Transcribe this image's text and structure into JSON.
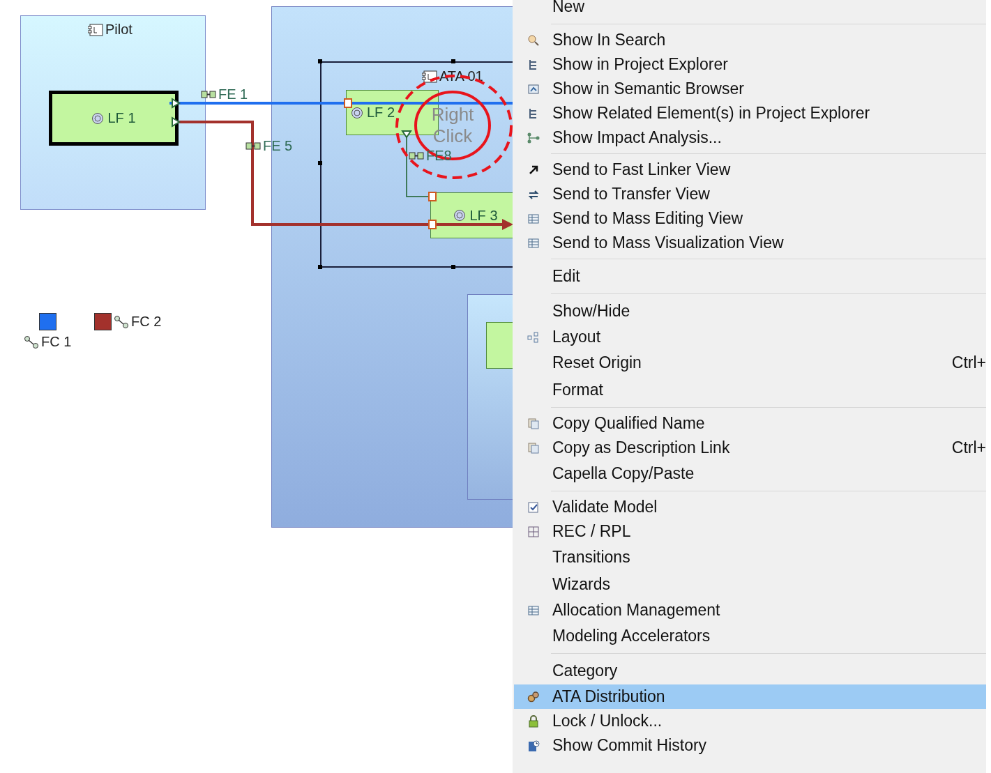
{
  "diagram": {
    "containers": [
      {
        "kind": "component",
        "label": "Pilot"
      },
      {
        "kind": "outer"
      },
      {
        "kind": "frame",
        "label": "ATA 01",
        "selected": true
      },
      {
        "kind": "inner"
      }
    ],
    "functions": [
      {
        "label": "LF 1",
        "selected": true
      },
      {
        "label": "LF 2",
        "selected": false
      },
      {
        "label": "LF 3",
        "selected": false
      },
      {
        "selected": false
      }
    ],
    "exchanges": [
      {
        "label": "FE 1",
        "color": "#1f6fef"
      },
      {
        "label": "FE 5",
        "color": "#a3312c"
      },
      {
        "label": "FE8",
        "color": "#3f7a5a"
      }
    ],
    "legend": [
      {
        "label": "FC 1",
        "color": "#1f6fef"
      },
      {
        "label": "FC 2",
        "color": "#a3312c"
      }
    ],
    "annotation": {
      "text": "Right Click"
    }
  },
  "context_menu": {
    "items": [
      {
        "kind": "item",
        "label": "New"
      },
      {
        "kind": "separator"
      },
      {
        "kind": "item",
        "label": "Show In Search",
        "selected": false
      },
      {
        "kind": "item",
        "label": "Show in Project Explorer",
        "selected": false
      },
      {
        "kind": "item",
        "label": "Show in Semantic Browser",
        "selected": false
      },
      {
        "kind": "item",
        "label": "Show Related Element(s) in Project Explorer",
        "selected": false
      },
      {
        "kind": "item",
        "label": "Show Impact Analysis...",
        "selected": false
      },
      {
        "kind": "separator"
      },
      {
        "kind": "item",
        "label": "Send to Fast Linker View",
        "selected": false
      },
      {
        "kind": "item",
        "label": "Send to Transfer View",
        "selected": false
      },
      {
        "kind": "item",
        "label": "Send to Mass Editing View",
        "selected": false
      },
      {
        "kind": "item",
        "label": "Send to Mass Visualization View",
        "selected": false
      },
      {
        "kind": "separator"
      },
      {
        "kind": "item",
        "label": "Edit",
        "selected": false
      },
      {
        "kind": "separator"
      },
      {
        "kind": "item",
        "label": "Show/Hide",
        "selected": false
      },
      {
        "kind": "item",
        "label": "Layout",
        "selected": false
      },
      {
        "kind": "item",
        "label": "Reset Origin",
        "shortcut": "Ctrl+",
        "selected": false
      },
      {
        "kind": "item",
        "label": "Format",
        "selected": false
      },
      {
        "kind": "separator"
      },
      {
        "kind": "item",
        "label": "Copy Qualified Name",
        "selected": false
      },
      {
        "kind": "item",
        "label": "Copy as Description Link",
        "shortcut": "Ctrl+",
        "selected": false
      },
      {
        "kind": "item",
        "label": "Capella Copy/Paste",
        "selected": false
      },
      {
        "kind": "separator"
      },
      {
        "kind": "item",
        "label": "Validate Model",
        "selected": false
      },
      {
        "kind": "item",
        "label": "REC / RPL",
        "selected": false
      },
      {
        "kind": "item",
        "label": "Transitions",
        "selected": false
      },
      {
        "kind": "item",
        "label": "Wizards",
        "selected": false
      },
      {
        "kind": "item",
        "label": "Allocation Management",
        "selected": false
      },
      {
        "kind": "item",
        "label": "Modeling Accelerators",
        "selected": false
      },
      {
        "kind": "separator"
      },
      {
        "kind": "item",
        "label": "Category",
        "selected": false
      },
      {
        "kind": "item",
        "label": "ATA Distribution",
        "selected": true
      },
      {
        "kind": "item",
        "label": "Lock / Unlock...",
        "selected": false
      },
      {
        "kind": "item",
        "label": "Show Commit History",
        "selected": false
      }
    ]
  }
}
